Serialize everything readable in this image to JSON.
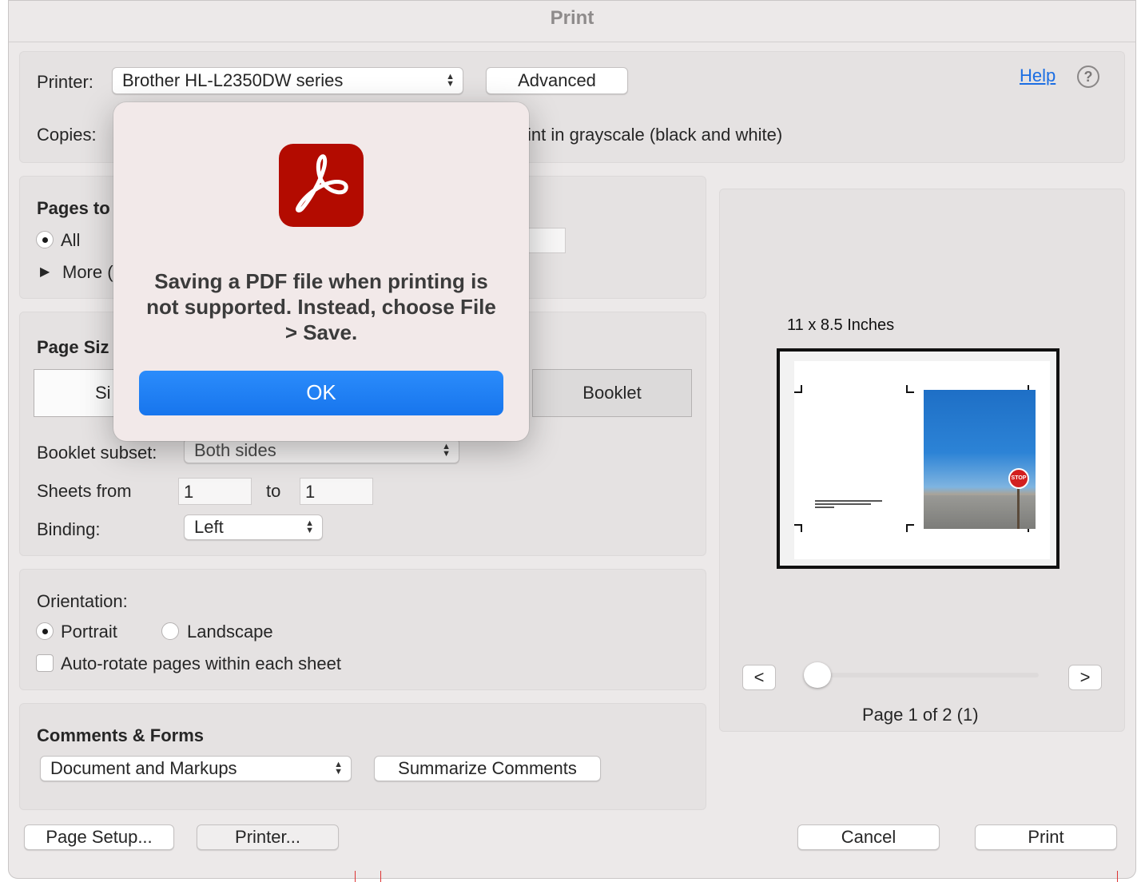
{
  "window": {
    "title": "Print"
  },
  "printer": {
    "label": "Printer:",
    "selected": "Brother HL-L2350DW series",
    "advanced_label": "Advanced",
    "help_label": "Help",
    "help_icon_glyph": "?"
  },
  "copies": {
    "label": "Copies:",
    "grayscale_label": "int in grayscale (black and white)"
  },
  "pages": {
    "header": "Pages to",
    "all_label": "All",
    "more_label": "More ("
  },
  "page_sizing": {
    "header": "Page Siz",
    "seg_size_label": "Si",
    "seg_booklet_label": "Booklet",
    "booklet_subset_label": "Booklet subset:",
    "booklet_subset_value": "Both sides",
    "sheets_from_label": "Sheets from",
    "sheets_from_value": "1",
    "to_label": "to",
    "sheets_to_value": "1",
    "binding_label": "Binding:",
    "binding_value": "Left"
  },
  "orientation": {
    "header": "Orientation:",
    "portrait_label": "Portrait",
    "landscape_label": "Landscape",
    "autorotate_label": "Auto-rotate pages within each sheet",
    "selected": "Portrait"
  },
  "comments": {
    "header": "Comments & Forms",
    "selected": "Document and Markups",
    "summarize_label": "Summarize Comments"
  },
  "preview": {
    "size_label": "11 x 8.5 Inches",
    "prev_label": "<",
    "next_label": ">",
    "page_status": "Page 1 of 2 (1)",
    "sign_text": "STOP",
    "slider_position": 0
  },
  "footer": {
    "page_setup_label": "Page Setup...",
    "printer_label": "Printer...",
    "cancel_label": "Cancel",
    "print_label": "Print"
  },
  "alert": {
    "icon": "acrobat-pdf-icon",
    "message": "Saving a PDF file when printing is not supported. Instead, choose File > Save.",
    "ok_label": "OK"
  },
  "colors": {
    "accent": "#1a7ef5",
    "link": "#1b6ee3",
    "acrobat_red": "#b30b00",
    "window_bg": "#ece9e9"
  }
}
